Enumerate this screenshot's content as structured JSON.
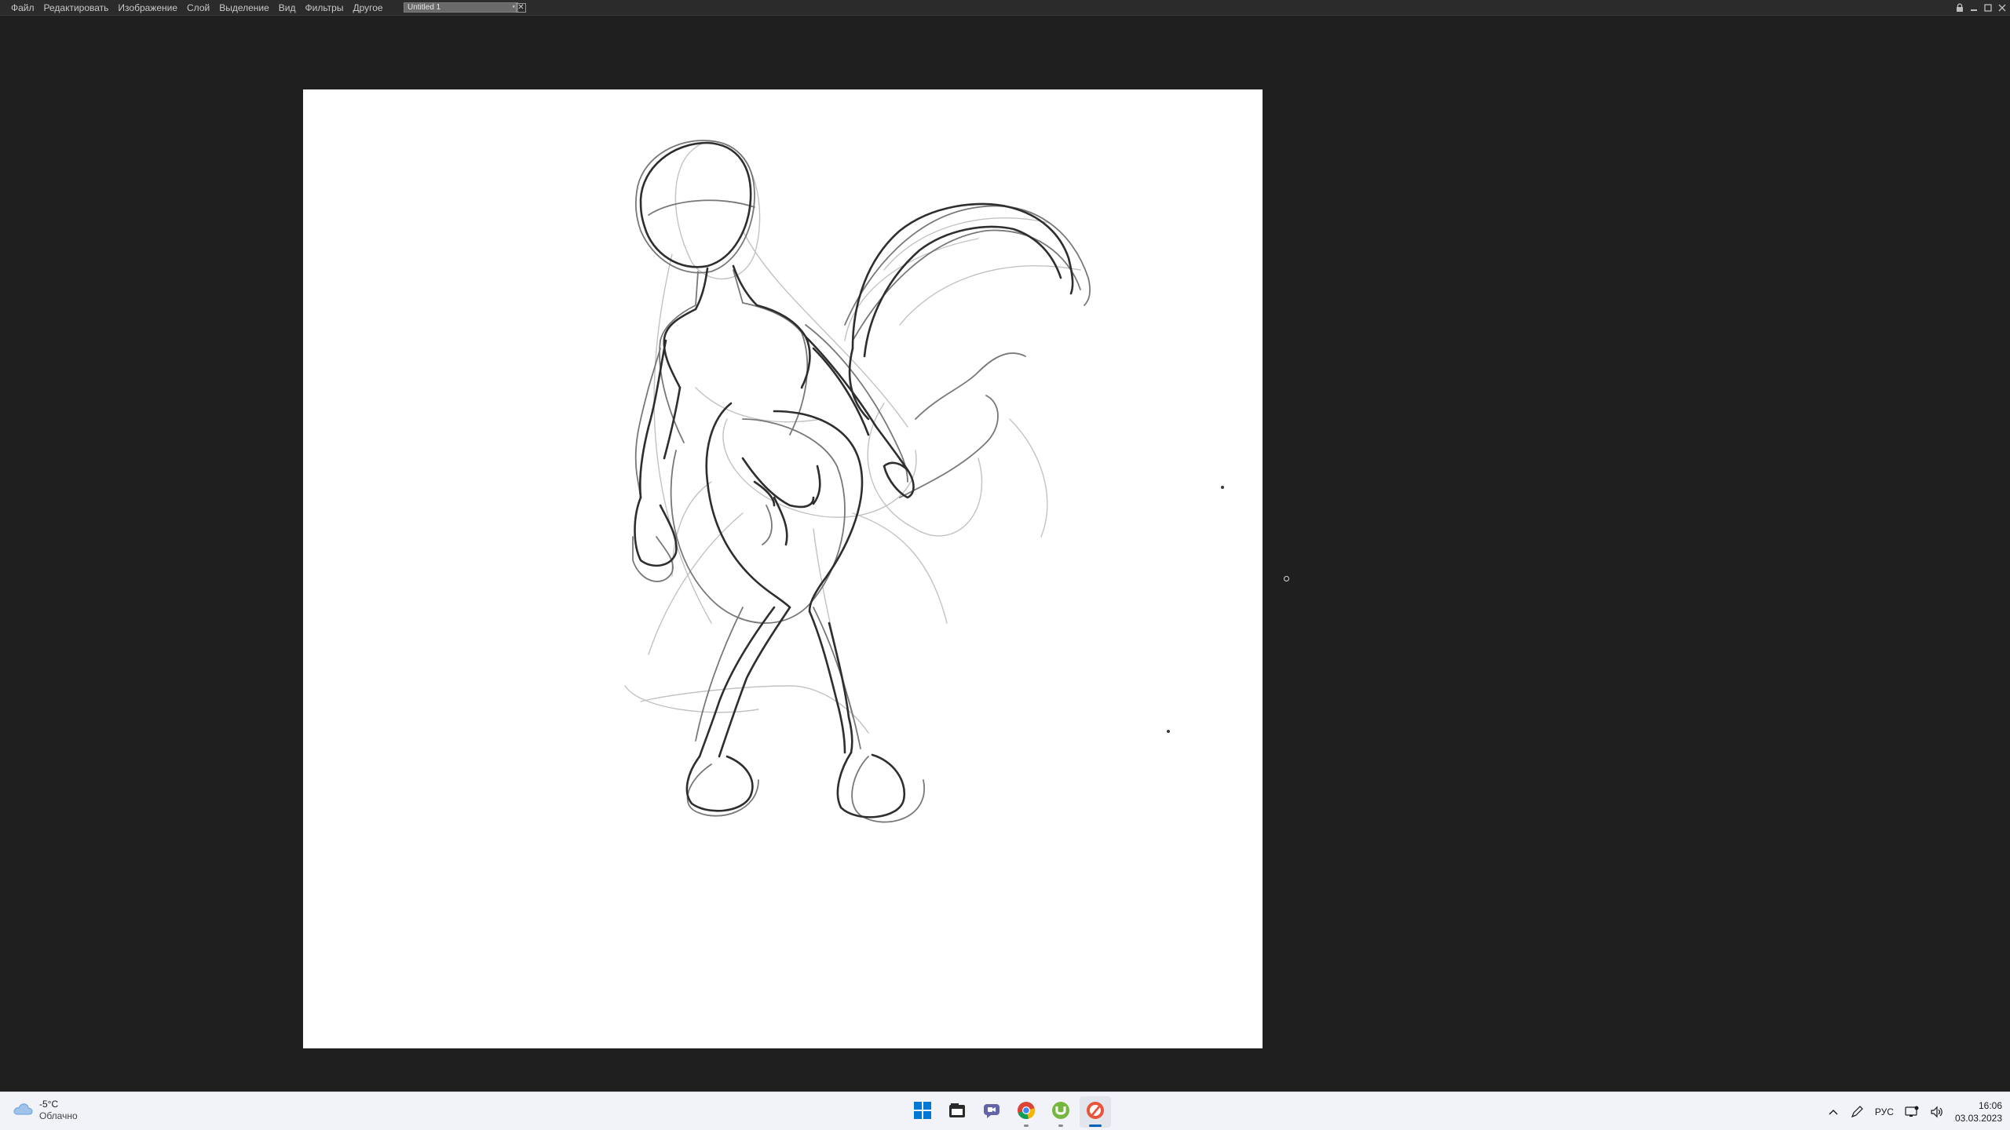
{
  "menubar": {
    "items": [
      "Файл",
      "Редактировать",
      "Изображение",
      "Слой",
      "Выделение",
      "Вид",
      "Фильтры",
      "Другое"
    ],
    "document_tab": {
      "title": "Untitled 1",
      "modified_mark": "*"
    }
  },
  "canvas": {
    "background": "#ffffff",
    "content": "pencil sketch"
  },
  "taskbar": {
    "weather": {
      "temp": "-5°C",
      "desc": "Облачно",
      "icon": "cloud-icon"
    },
    "apps": [
      "windows-start-icon",
      "file-explorer-icon",
      "teams-chat-icon",
      "chrome-icon",
      "utorrent-icon",
      "drawing-app-icon"
    ],
    "tray": {
      "language": "РУС",
      "time": "16:06",
      "date": "03.03.2023"
    }
  },
  "colors": {
    "workspace": "#1f1f1f",
    "menubar": "#2b2b2b",
    "taskbar": "#f1f3f8",
    "accent": "#005fb8"
  }
}
